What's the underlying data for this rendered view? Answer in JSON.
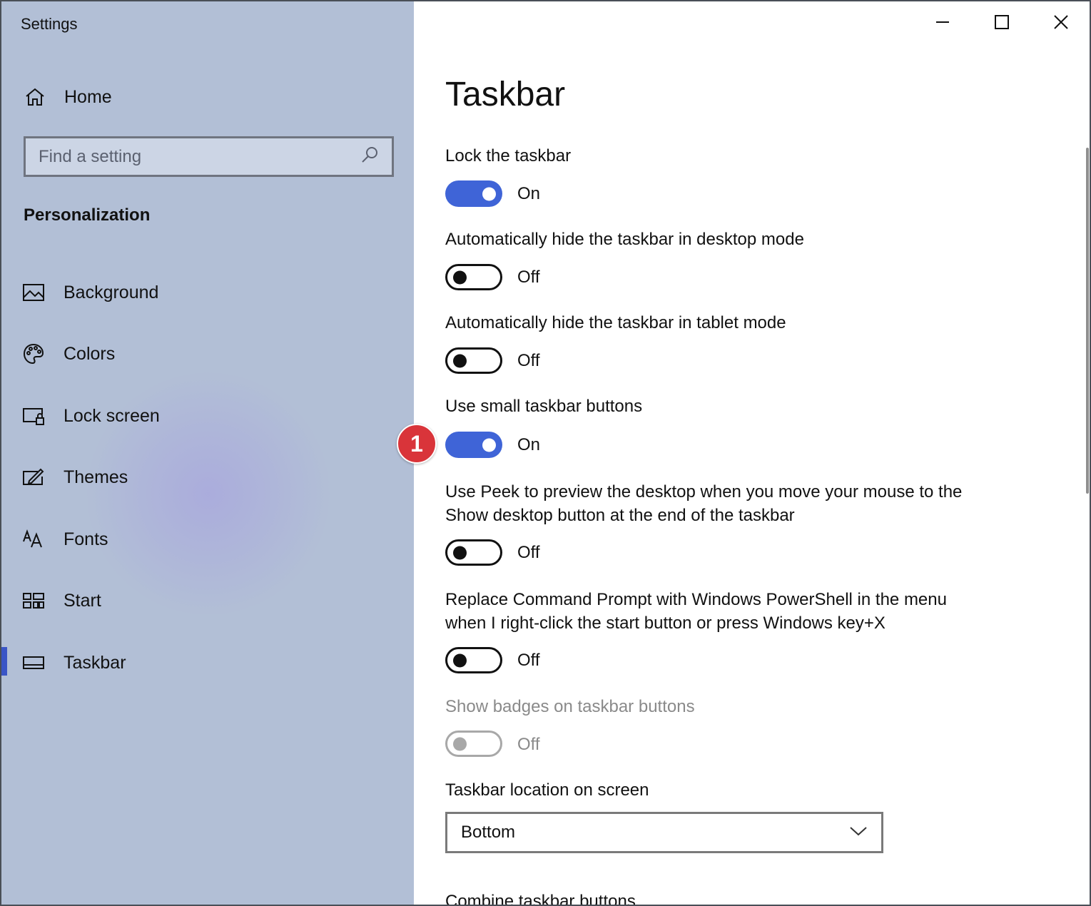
{
  "window": {
    "title": "Settings",
    "controls": [
      "minimize",
      "maximize",
      "close"
    ]
  },
  "sidebar": {
    "home_label": "Home",
    "search_placeholder": "Find a setting",
    "section_title": "Personalization",
    "items": [
      {
        "label": "Background",
        "icon": "picture-icon",
        "active": false
      },
      {
        "label": "Colors",
        "icon": "palette-icon",
        "active": false
      },
      {
        "label": "Lock screen",
        "icon": "lock-screen-icon",
        "active": false
      },
      {
        "label": "Themes",
        "icon": "themes-icon",
        "active": false
      },
      {
        "label": "Fonts",
        "icon": "fonts-icon",
        "active": false
      },
      {
        "label": "Start",
        "icon": "start-icon",
        "active": false
      },
      {
        "label": "Taskbar",
        "icon": "taskbar-icon",
        "active": true
      }
    ]
  },
  "main": {
    "title": "Taskbar",
    "settings": [
      {
        "label": "Lock the taskbar",
        "state": "On"
      },
      {
        "label": "Automatically hide the taskbar in desktop mode",
        "state": "Off"
      },
      {
        "label": "Automatically hide the taskbar in tablet mode",
        "state": "Off"
      },
      {
        "label": "Use small taskbar buttons",
        "state": "On"
      },
      {
        "label_line1": "Use Peek to preview the desktop when you move your mouse to the",
        "label_line2": "Show desktop button at the end of the taskbar",
        "state": "Off"
      },
      {
        "label_line1": "Replace Command Prompt with Windows PowerShell in the menu",
        "label_line2": "when I right-click the start button or press Windows key+X",
        "state": "Off"
      },
      {
        "label": "Show badges on taskbar buttons",
        "state": "Off",
        "disabled": true
      }
    ],
    "location_label": "Taskbar location on screen",
    "location_value": "Bottom",
    "combine_label": "Combine taskbar buttons"
  },
  "annotation": {
    "marker": "1"
  },
  "colors": {
    "accent": "#3f64d7",
    "sidebar_bg": "#b2bfd6",
    "marker": "#d9343a"
  }
}
